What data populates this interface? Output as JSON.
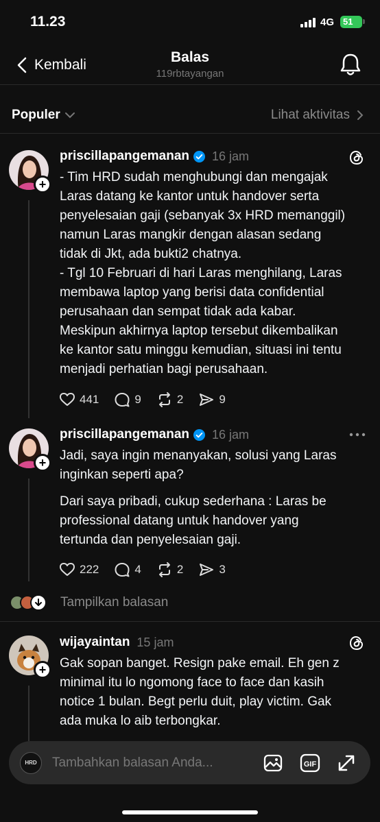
{
  "status_bar": {
    "time": "11.23",
    "network": "4G",
    "battery": "51"
  },
  "header": {
    "back_label": "Kembali",
    "title": "Balas",
    "subtitle": "119rbtayangan"
  },
  "sort": {
    "selected": "Populer",
    "activity_label": "Lihat aktivitas"
  },
  "posts": [
    {
      "username": "priscillapangemanan",
      "time": "16 jam",
      "lines": [
        "- Tim HRD sudah menghubungi dan mengajak",
        "Laras datang ke kantor untuk handover serta",
        "penyelesaian gaji (sebanyak 3x HRD memanggil)",
        "namun Laras mangkir dengan alasan sedang",
        "tidak di Jkt, ada bukti2 chatnya.",
        "- Tgl 10 Februari di hari Laras menghilang, Laras",
        "membawa laptop yang berisi data confidential",
        "perusahaan dan sempat tidak ada kabar.",
        "Meskipun akhirnya laptop tersebut dikembalikan",
        "ke kantor satu minggu kemudian, situasi ini tentu",
        "menjadi perhatian bagi perusahaan."
      ],
      "likes": "441",
      "replies": "9",
      "reposts": "2",
      "shares": "9"
    },
    {
      "username": "priscillapangemanan",
      "time": "16 jam",
      "para1": [
        "Jadi, saya ingin menanyakan, solusi yang Laras",
        "inginkan seperti apa?"
      ],
      "para2": [
        "Dari saya pribadi, cukup sederhana : Laras be",
        "professional datang untuk handover yang",
        "tertunda dan penyelesaian gaji."
      ],
      "likes": "222",
      "replies": "4",
      "reposts": "2",
      "shares": "3"
    },
    {
      "username": "wijayaintan",
      "time": "15 jam",
      "lines": [
        "Gak sopan banget. Resign pake email. Eh gen z",
        "minimal itu lo ngomong face to face dan kasih",
        "notice 1 bulan. Begt perlu duit, play victim. Gak",
        "ada muka lo aib terbongkar."
      ]
    }
  ],
  "show_replies_label": "Tampilkan balasan",
  "composer": {
    "logo_text": "HRD",
    "placeholder": "Tambahkan balasan Anda..."
  },
  "colors": {
    "background": "#101010",
    "verified": "#0095f6",
    "battery": "#34c759",
    "muted": "#777777"
  }
}
